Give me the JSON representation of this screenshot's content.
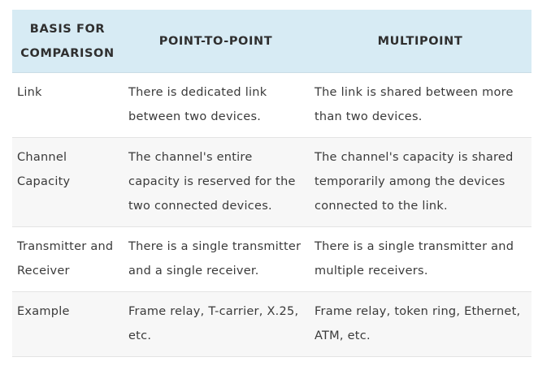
{
  "table": {
    "headers": {
      "basis_line1": "BASIS FOR",
      "basis_line2": "COMPARISON",
      "point_to_point": "POINT-TO-POINT",
      "multipoint": "MULTIPOINT"
    },
    "rows": [
      {
        "basis": "Link",
        "point_to_point": "There is dedicated link between two devices.",
        "multipoint": "The link is shared between more than two devices."
      },
      {
        "basis": "Channel Capacity",
        "point_to_point": "The channel's entire capacity is reserved for the two connected devices.",
        "multipoint": "The channel's capacity is shared temporarily among the devices connected to the link."
      },
      {
        "basis": "Transmitter and Receiver",
        "point_to_point": "There is a single transmitter and a single receiver.",
        "multipoint": "There is a single transmitter and multiple receivers."
      },
      {
        "basis": "Example",
        "point_to_point": "Frame relay, T-carrier, X.25, etc.",
        "multipoint": "Frame relay, token ring, Ethernet, ATM, etc."
      }
    ]
  }
}
